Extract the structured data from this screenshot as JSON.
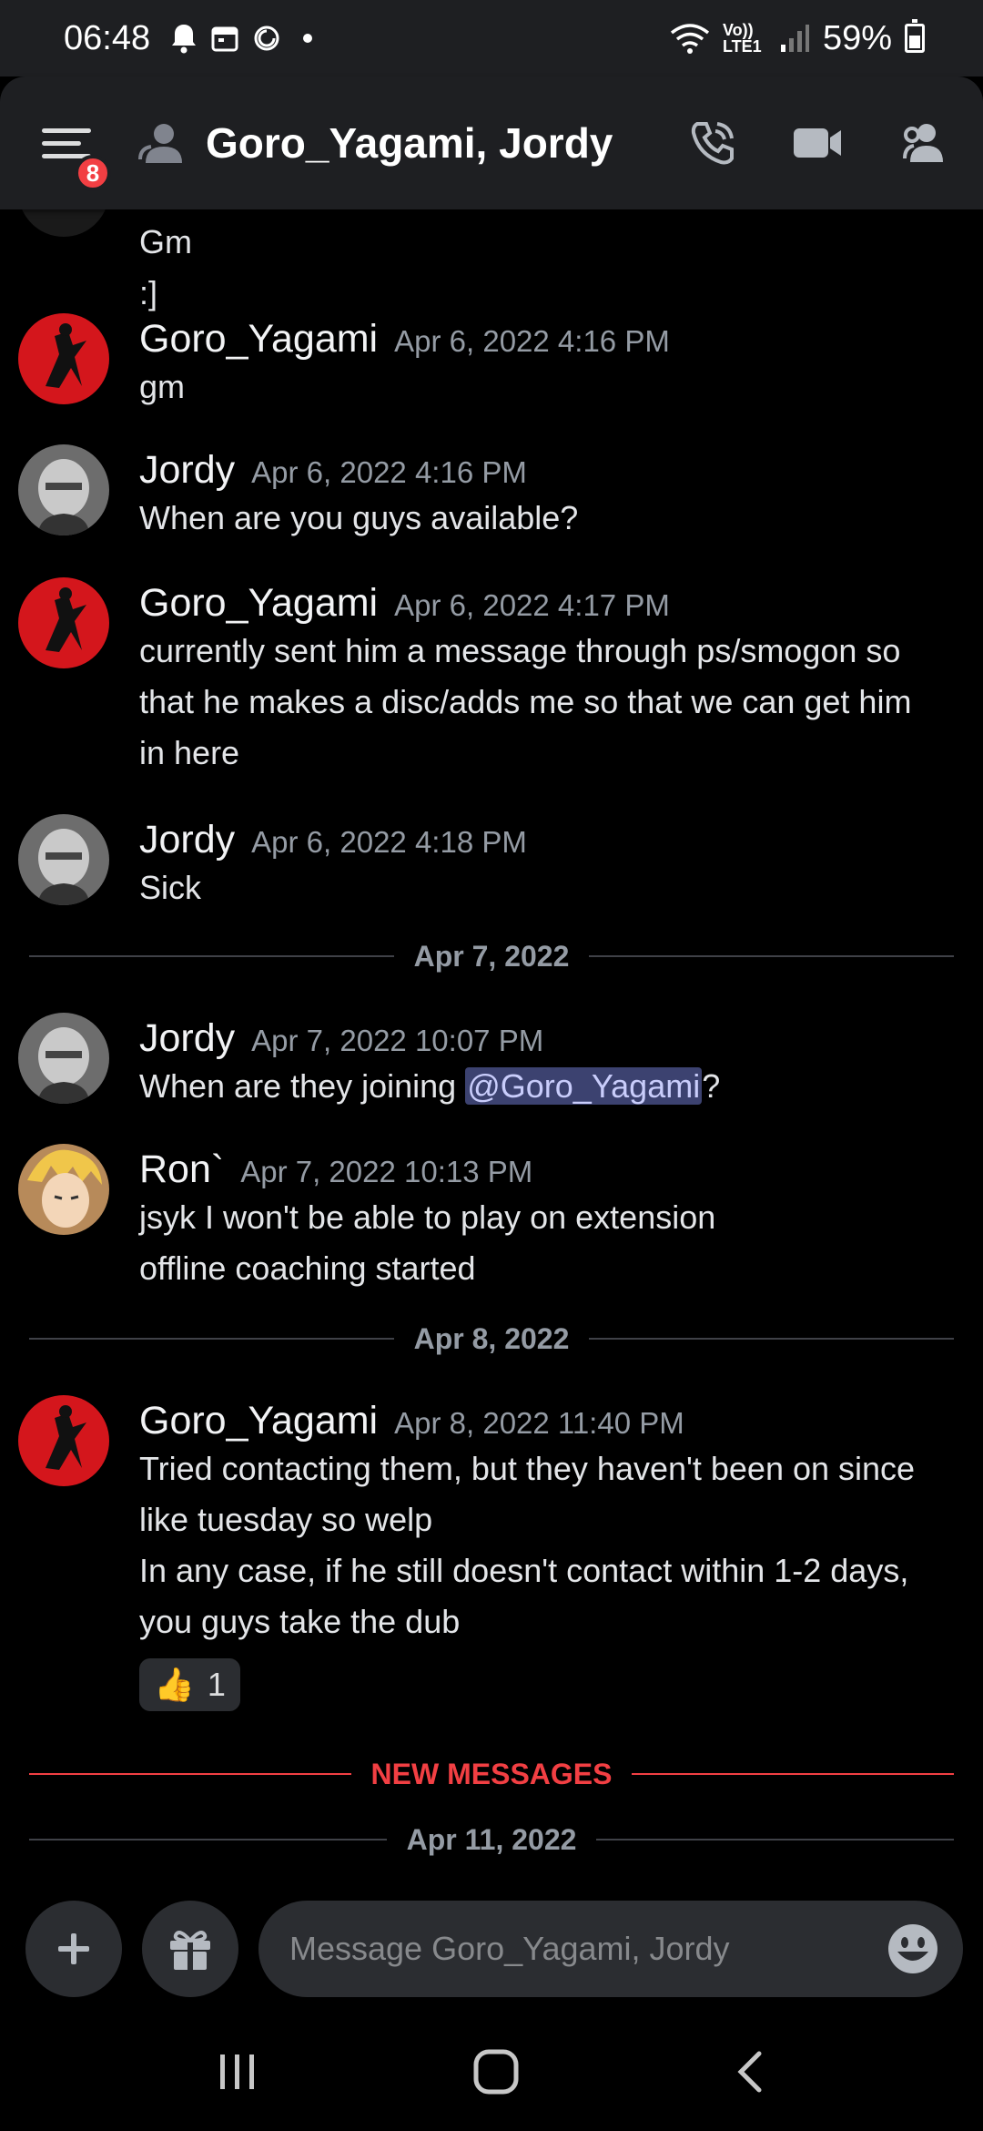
{
  "status_bar": {
    "time": "06:48",
    "network": "Vo)) LTE1",
    "battery": "59%"
  },
  "header": {
    "title": "Goro_Yagami, Jordy",
    "unread_badge": "8"
  },
  "messages": [
    {
      "author": "",
      "timestamp": "",
      "lines": [
        "Gm",
        ":]"
      ]
    },
    {
      "author": "Goro_Yagami",
      "timestamp": "Apr 6, 2022 4:16 PM",
      "lines": [
        "gm"
      ]
    },
    {
      "author": "Jordy",
      "timestamp": "Apr 6, 2022 4:16 PM",
      "lines": [
        "When are you guys available?"
      ]
    },
    {
      "author": "Goro_Yagami",
      "timestamp": "Apr 6, 2022 4:17 PM",
      "lines": [
        "currently sent him a message through ps/smogon so",
        "that he makes a disc/adds me so that we can get him",
        "in here"
      ]
    },
    {
      "author": "Jordy",
      "timestamp": "Apr 6, 2022 4:18 PM",
      "lines": [
        "Sick"
      ]
    },
    {
      "author": "Jordy",
      "timestamp": "Apr 7, 2022 10:07 PM",
      "line_prefix": "When are they joining ",
      "mention": "@Goro_Yagami",
      "line_suffix": "?"
    },
    {
      "author": "Ron`",
      "timestamp": "Apr 7, 2022 10:13 PM",
      "lines": [
        "jsyk I won't be able to play on extension",
        "offline coaching started"
      ]
    },
    {
      "author": "Goro_Yagami",
      "timestamp": "Apr 8, 2022 11:40 PM",
      "lines": [
        "Tried contacting them, but they haven't been on since",
        "like tuesday so welp",
        "In any case, if he still doesn't contact within 1-2 days,",
        "you guys take the dub"
      ],
      "reaction": {
        "emoji": "👍",
        "count": "1"
      }
    }
  ],
  "dividers": {
    "apr7": "Apr 7, 2022",
    "apr8": "Apr 8, 2022",
    "new_messages": "NEW MESSAGES",
    "apr11": "Apr 11, 2022"
  },
  "composer": {
    "placeholder": "Message Goro_Yagami, Jordy"
  },
  "colors": {
    "background": "#000000",
    "header": "#1e1f22",
    "accent_red": "#f23f43",
    "mention_bg": "#3c4270"
  },
  "icons": [
    "bell-icon",
    "calendar-icon",
    "sync-icon",
    "wifi-icon",
    "signal-icon",
    "battery-icon",
    "hamburger-menu-icon",
    "dm-user-icon",
    "voice-call-icon",
    "video-call-icon",
    "members-icon",
    "plus-icon",
    "gift-icon",
    "emoji-icon",
    "recents-nav-icon",
    "home-nav-icon",
    "back-nav-icon"
  ]
}
